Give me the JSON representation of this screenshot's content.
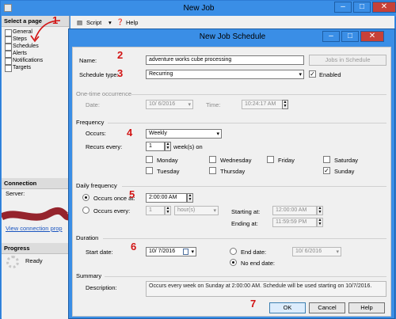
{
  "back_window": {
    "title": "New Job",
    "select_page_header": "Select a page",
    "pages": [
      "General",
      "Steps",
      "Schedules",
      "Alerts",
      "Notifications",
      "Targets"
    ],
    "toolbar": {
      "script": "Script",
      "help": "Help"
    },
    "connection_header": "Connection",
    "server_label": "Server:",
    "view_connection": "View connection prop",
    "progress_header": "Progress",
    "progress_status": "Ready"
  },
  "dialog": {
    "title": "New Job Schedule",
    "name_label": "Name:",
    "name_value": "adventure works cube processing",
    "jobs_in_schedule": "Jobs in Schedule",
    "schedule_type_label": "Schedule type:",
    "schedule_type_value": "Recurring",
    "enabled_label": "Enabled",
    "one_time_header": "One-time occurrence",
    "date_label": "Date:",
    "one_time_date": "10/ 6/2016",
    "time_label": "Time:",
    "one_time_time": "10:24:17 AM",
    "frequency_header": "Frequency",
    "occurs_label": "Occurs:",
    "occurs_value": "Weekly",
    "recurs_every_label": "Recurs every:",
    "recurs_every_value": "1",
    "recurs_unit": "week(s) on",
    "days": {
      "monday": "Monday",
      "tuesday": "Tuesday",
      "wednesday": "Wednesday",
      "thursday": "Thursday",
      "friday": "Friday",
      "saturday": "Saturday",
      "sunday": "Sunday"
    },
    "daily_header": "Daily frequency",
    "occurs_once_label": "Occurs once at:",
    "occurs_once_value": "2:00:00 AM",
    "occurs_every_label": "Occurs every:",
    "occurs_every_value": "1",
    "occurs_every_unit": "hour(s)",
    "starting_at_label": "Starting at:",
    "starting_at_value": "12:00:00 AM",
    "ending_at_label": "Ending at:",
    "ending_at_value": "11:59:59 PM",
    "duration_header": "Duration",
    "start_date_label": "Start date:",
    "start_date_value": "10/ 7/2016",
    "end_date_label": "End date:",
    "end_date_value": "10/ 6/2016",
    "no_end_date_label": "No end date:",
    "summary_header": "Summary",
    "description_label": "Description:",
    "description_value": "Occurs every week on Sunday at 2:00:00 AM. Schedule will be used starting on 10/7/2016.",
    "ok": "OK",
    "cancel": "Cancel",
    "help": "Help"
  },
  "annotations": [
    "1",
    "2",
    "3",
    "4",
    "5",
    "6",
    "7"
  ],
  "colors": {
    "title_bar": "#3a8ee6",
    "close_button": "#c74138",
    "annotation": "#d21414"
  }
}
